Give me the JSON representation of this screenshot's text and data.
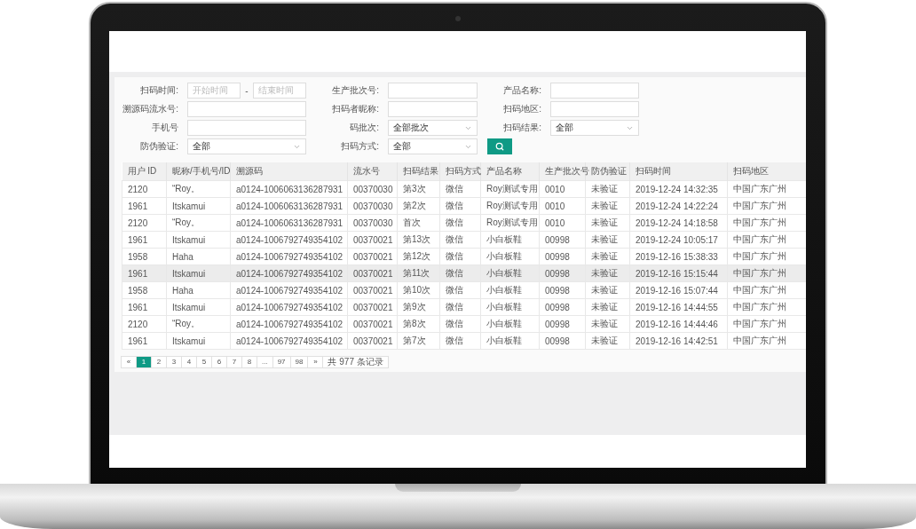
{
  "filters": [
    [
      {
        "kind": "range",
        "label": "扫码时间:",
        "placeholders": [
          "开始时间",
          "结束时间"
        ],
        "separator": "-"
      },
      {
        "kind": "text",
        "label": "生产批次号:"
      },
      {
        "kind": "text",
        "label": "产品名称:"
      }
    ],
    [
      {
        "kind": "text",
        "label": "溯源码流水号:"
      },
      {
        "kind": "text",
        "label": "扫码者昵称:"
      },
      {
        "kind": "text",
        "label": "扫码地区:"
      }
    ],
    [
      {
        "kind": "text",
        "label": "手机号"
      },
      {
        "kind": "select",
        "label": "码批次:",
        "value": "全部批次"
      },
      {
        "kind": "select",
        "label": "扫码结果:",
        "value": "全部"
      }
    ],
    [
      {
        "kind": "select",
        "label": "防伪验证:",
        "value": "全部"
      },
      {
        "kind": "select",
        "label": "扫码方式:",
        "value": "全部"
      },
      {
        "kind": "search"
      }
    ]
  ],
  "table": {
    "columns": [
      "用户 ID",
      "昵称/手机号/ID",
      "溯源码",
      "流水号",
      "扫码结果",
      "扫码方式",
      "产品名称",
      "生产批次号",
      "防伪验证",
      "扫码时间",
      "扫码地区"
    ],
    "rows": [
      {
        "selected": false,
        "cells": [
          "2120",
          "“Roy。",
          "a0124-1006063136287931",
          "00370030",
          "第3次",
          "微信",
          "Roy测试专用",
          "0010",
          "未验证",
          "2019-12-24 14:32:35",
          "中国广东广州"
        ]
      },
      {
        "selected": false,
        "cells": [
          "1961",
          "Itskamui",
          "a0124-1006063136287931",
          "00370030",
          "第2次",
          "微信",
          "Roy测试专用",
          "0010",
          "未验证",
          "2019-12-24 14:22:24",
          "中国广东广州"
        ]
      },
      {
        "selected": false,
        "cells": [
          "2120",
          "“Roy。",
          "a0124-1006063136287931",
          "00370030",
          "首次",
          "微信",
          "Roy测试专用",
          "0010",
          "未验证",
          "2019-12-24 14:18:58",
          "中国广东广州"
        ]
      },
      {
        "selected": false,
        "cells": [
          "1961",
          "Itskamui",
          "a0124-1006792749354102",
          "00370021",
          "第13次",
          "微信",
          "小白板鞋",
          "00998",
          "未验证",
          "2019-12-24 10:05:17",
          "中国广东广州"
        ]
      },
      {
        "selected": false,
        "cells": [
          "1958",
          "Haha",
          "a0124-1006792749354102",
          "00370021",
          "第12次",
          "微信",
          "小白板鞋",
          "00998",
          "未验证",
          "2019-12-16 15:38:33",
          "中国广东广州"
        ]
      },
      {
        "selected": true,
        "cells": [
          "1961",
          "Itskamui",
          "a0124-1006792749354102",
          "00370021",
          "第11次",
          "微信",
          "小白板鞋",
          "00998",
          "未验证",
          "2019-12-16 15:15:44",
          "中国广东广州"
        ]
      },
      {
        "selected": false,
        "cells": [
          "1958",
          "Haha",
          "a0124-1006792749354102",
          "00370021",
          "第10次",
          "微信",
          "小白板鞋",
          "00998",
          "未验证",
          "2019-12-16 15:07:44",
          "中国广东广州"
        ]
      },
      {
        "selected": false,
        "cells": [
          "1961",
          "Itskamui",
          "a0124-1006792749354102",
          "00370021",
          "第9次",
          "微信",
          "小白板鞋",
          "00998",
          "未验证",
          "2019-12-16 14:44:55",
          "中国广东广州"
        ]
      },
      {
        "selected": false,
        "cells": [
          "2120",
          "“Roy。",
          "a0124-1006792749354102",
          "00370021",
          "第8次",
          "微信",
          "小白板鞋",
          "00998",
          "未验证",
          "2019-12-16 14:44:46",
          "中国广东广州"
        ]
      },
      {
        "selected": false,
        "cells": [
          "1961",
          "Itskamui",
          "a0124-1006792749354102",
          "00370021",
          "第7次",
          "微信",
          "小白板鞋",
          "00998",
          "未验证",
          "2019-12-16 14:42:51",
          "中国广东广州"
        ]
      }
    ]
  },
  "pagination": {
    "prev": "«",
    "pages": [
      {
        "label": "1",
        "selected": true
      },
      {
        "label": "2",
        "selected": false
      },
      {
        "label": "3",
        "selected": false
      },
      {
        "label": "4",
        "selected": false
      },
      {
        "label": "5",
        "selected": false
      },
      {
        "label": "6",
        "selected": false
      },
      {
        "label": "7",
        "selected": false
      },
      {
        "label": "8",
        "selected": false
      },
      {
        "label": "...",
        "selected": false
      },
      {
        "label": "97",
        "selected": false
      },
      {
        "label": "98",
        "selected": false
      }
    ],
    "next": "»",
    "total": "共 977 条记录"
  }
}
